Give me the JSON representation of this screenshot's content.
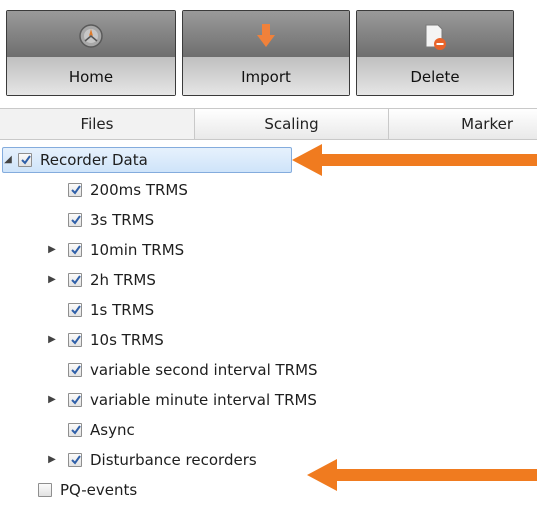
{
  "toolbar": {
    "buttons": [
      {
        "label": "Home",
        "icon": "home-icon"
      },
      {
        "label": "Import",
        "icon": "import-arrow-icon"
      },
      {
        "label": "Delete",
        "icon": "delete-document-icon"
      }
    ]
  },
  "tabs": [
    {
      "label": "Files",
      "selected": true
    },
    {
      "label": "Scaling",
      "selected": false
    },
    {
      "label": "Marker",
      "selected": false
    }
  ],
  "tree": {
    "root": {
      "label": "Recorder Data",
      "expanded": true,
      "checked": true
    },
    "children": [
      {
        "label": "200ms TRMS",
        "expandable": false,
        "checked": true
      },
      {
        "label": "3s TRMS",
        "expandable": false,
        "checked": true
      },
      {
        "label": "10min TRMS",
        "expandable": true,
        "checked": true
      },
      {
        "label": "2h TRMS",
        "expandable": true,
        "checked": true
      },
      {
        "label": "1s TRMS",
        "expandable": false,
        "checked": true
      },
      {
        "label": "10s TRMS",
        "expandable": true,
        "checked": true
      },
      {
        "label": "variable second interval TRMS",
        "expandable": false,
        "checked": true
      },
      {
        "label": "variable minute interval TRMS",
        "expandable": true,
        "checked": true
      },
      {
        "label": "Async",
        "expandable": false,
        "checked": true
      },
      {
        "label": "Disturbance recorders",
        "expandable": true,
        "checked": true
      }
    ],
    "sibling": {
      "label": "PQ-events",
      "checked": false
    }
  },
  "colors": {
    "annotation_arrow": "#f07b1f",
    "selection": "#cfe4fa",
    "toolbar_dark": "#2b2b2b"
  }
}
